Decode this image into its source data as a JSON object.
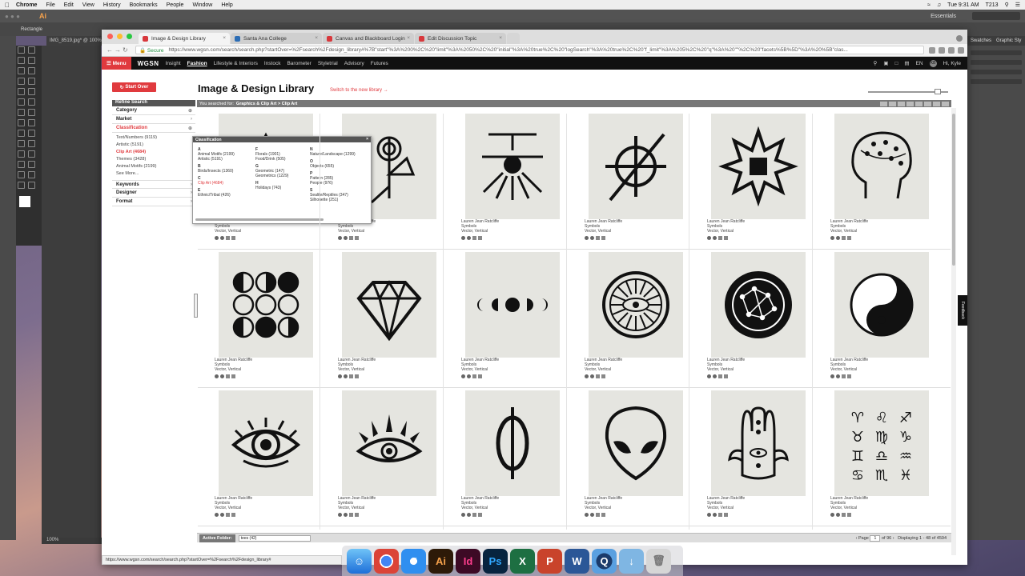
{
  "menubar": {
    "app": "Chrome",
    "items": [
      "File",
      "Edit",
      "View",
      "History",
      "Bookmarks",
      "People",
      "Window",
      "Help"
    ],
    "time": "Tue 9:31 AM",
    "user": "T213"
  },
  "illustrator": {
    "logo": "Ai",
    "workspace": "Essentials",
    "search_placeholder": "Search Adobe Help",
    "tool_name": "Rectangle",
    "doc_tab": "IMG_8519.jpg* @ 100%",
    "zoom": "100%",
    "panel_tabs": [
      "Swatches",
      "Graphic Sty"
    ]
  },
  "browser": {
    "tabs": [
      {
        "title": "Image & Design Library",
        "color": "#d8383c"
      },
      {
        "title": "Santa Ana College",
        "color": "#2c6db5"
      },
      {
        "title": "Canvas and Blackboard Login",
        "color": "#d8383c"
      },
      {
        "title": "Edit Discussion Topic",
        "color": "#d8383c"
      }
    ],
    "secure_label": "Secure",
    "url": "https://www.wgsn.com/search/search.php?startOver=%2Fsearch%2Fdesign_library#%7B\"start\"%3A%200%2C%20\"limit\"%3A%2050%2C%20\"initial\"%3A%20true%2C%20\"logSearch\"%3A%20true%2C%20\"f_limit\"%3A%205%2C%20\"q\"%3A%20\"\"%2C%20\"facets%5B%5D\"%3A%20%5B\"clas...",
    "status_url": "https://www.wgsn.com/search/search.php?startOver=%2Fsearch%2Fdesign_library#"
  },
  "nav": {
    "menu": "Menu",
    "logo": "WGSN",
    "items": [
      "Insight",
      "Fashion",
      "Lifestyle & Interiors",
      "Instock",
      "Barometer",
      "Styletrial",
      "Advisory",
      "Futures"
    ],
    "active": "Fashion",
    "lang": "EN",
    "greeting": "Hi, Kyle",
    "avatar": "KB"
  },
  "page": {
    "start_over": "Start Over",
    "refine": "Refine Search",
    "title": "Image & Design Library",
    "switch_link": "Switch to the new library →",
    "searched_for": "You searched for:",
    "crumb": "Graphics & Clip Art > Clip Art",
    "facets": [
      "Category",
      "Market",
      "Classification",
      "Keywords",
      "Designer",
      "Format"
    ],
    "classification_items": [
      "Text/Numbers (9119)",
      "Artistic (5191)",
      "Clip Art (4684)",
      "Themes (3428)",
      "Animal Motifs (2199)",
      "See More..."
    ],
    "active_folder_label": "Active Folder:",
    "active_folder_value": "tees (42)",
    "page_label": "Page",
    "page_value": "1",
    "page_of": "of 96",
    "displaying": "Displaying 1 - 48 of 4594",
    "feedback": "Feedback"
  },
  "popup": {
    "title": "Classification",
    "col1": [
      {
        "letter": "A",
        "items": [
          "Animal Motifs (2199)",
          "Artistic (5191)"
        ]
      },
      {
        "letter": "B",
        "items": [
          "Birds/Insects (1360)"
        ]
      },
      {
        "letter": "C",
        "items": [
          "Clip Art (4684)"
        ]
      },
      {
        "letter": "E",
        "items": [
          "Ethnic/Tribal (426)"
        ]
      }
    ],
    "col2": [
      {
        "letter": "F",
        "items": [
          "Florals (1901)",
          "Food/Drink (505)"
        ]
      },
      {
        "letter": "G",
        "items": [
          "Geometric (147)",
          "Geometrics (1229)"
        ]
      },
      {
        "letter": "H",
        "items": [
          "Holidays (743)"
        ]
      }
    ],
    "col3": [
      {
        "letter": "N",
        "items": [
          "Nature/Landscape (1299)"
        ]
      },
      {
        "letter": "O",
        "items": [
          "Objects (655)"
        ]
      },
      {
        "letter": "P",
        "items": [
          "Pattern (285)",
          "People (976)"
        ]
      },
      {
        "letter": "S",
        "items": [
          "Sealife/Reptiles (347)",
          "Silhouette (251)"
        ]
      }
    ]
  },
  "results": {
    "designer": "Lauren Jean Ratcliffe",
    "category": "Symbols",
    "format": "Vector, Vertical",
    "items": [
      "triangle-eye",
      "sun-circle-letters",
      "sun-rays",
      "circle-slash",
      "star-square",
      "phrenology-head",
      "moon-phase-circles",
      "diamond",
      "moon-phases",
      "all-seeing-eye-circle",
      "constellation-circle",
      "yin-yang",
      "eye-lashes",
      "eye-rays",
      "phi",
      "alien-head",
      "hamsa",
      "zodiac-signs"
    ]
  },
  "dock": [
    "Finder",
    "Chrome",
    "Safari",
    "Illustrator",
    "InDesign",
    "Photoshop",
    "Excel",
    "PowerPoint",
    "Word",
    "QuickTime",
    "Downloads",
    "Trash"
  ]
}
